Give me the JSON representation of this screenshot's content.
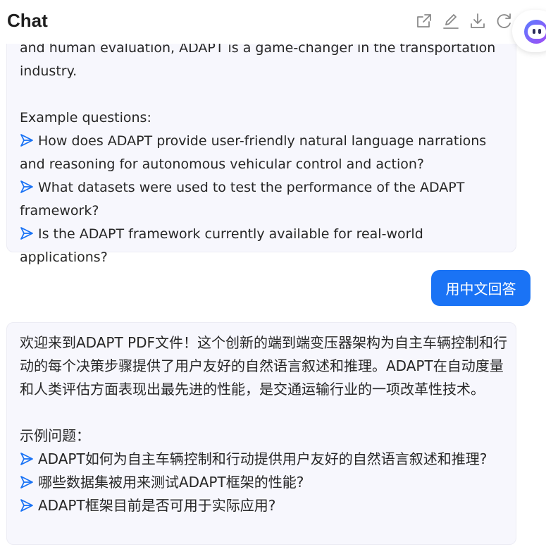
{
  "header": {
    "title": "Chat",
    "tools": [
      {
        "name": "share-icon"
      },
      {
        "name": "edit-icon"
      },
      {
        "name": "download-icon"
      },
      {
        "name": "refresh-icon"
      }
    ]
  },
  "avatar": {
    "icon": "assistant-avatar-icon"
  },
  "messages": {
    "assistant_en": {
      "intro_tail": "and human evaluation, ADAPT is a game-changer in the transportation industry.",
      "example_heading": "Example questions:",
      "questions": [
        "How does ADAPT provide user-friendly natural language narrations and reasoning for autonomous vehicular control and action?",
        "What datasets were used to test the performance of the ADAPT framework?",
        "Is the ADAPT framework currently available for real-world applications?"
      ]
    },
    "user": {
      "text": "用中文回答"
    },
    "assistant_zh": {
      "intro": "欢迎来到ADAPT PDF文件！这个创新的端到端变压器架构为自主车辆控制和行动的每个决策步骤提供了用户友好的自然语言叙述和推理。ADAPT在自动度量和人类评估方面表现出最先进的性能，是交通运输行业的一项改革性技术。",
      "example_heading": "示例问题：",
      "questions": [
        "ADAPT如何为自主车辆控制和行动提供用户友好的自然语言叙述和推理?",
        "哪些数据集被用来测试ADAPT框架的性能?",
        "ADAPT框架目前是否可用于实际应用?"
      ]
    }
  },
  "colors": {
    "accent": "#1a73f5",
    "bubble_bg": "#f7f7fd",
    "question_arrow": "#1a73f5"
  }
}
